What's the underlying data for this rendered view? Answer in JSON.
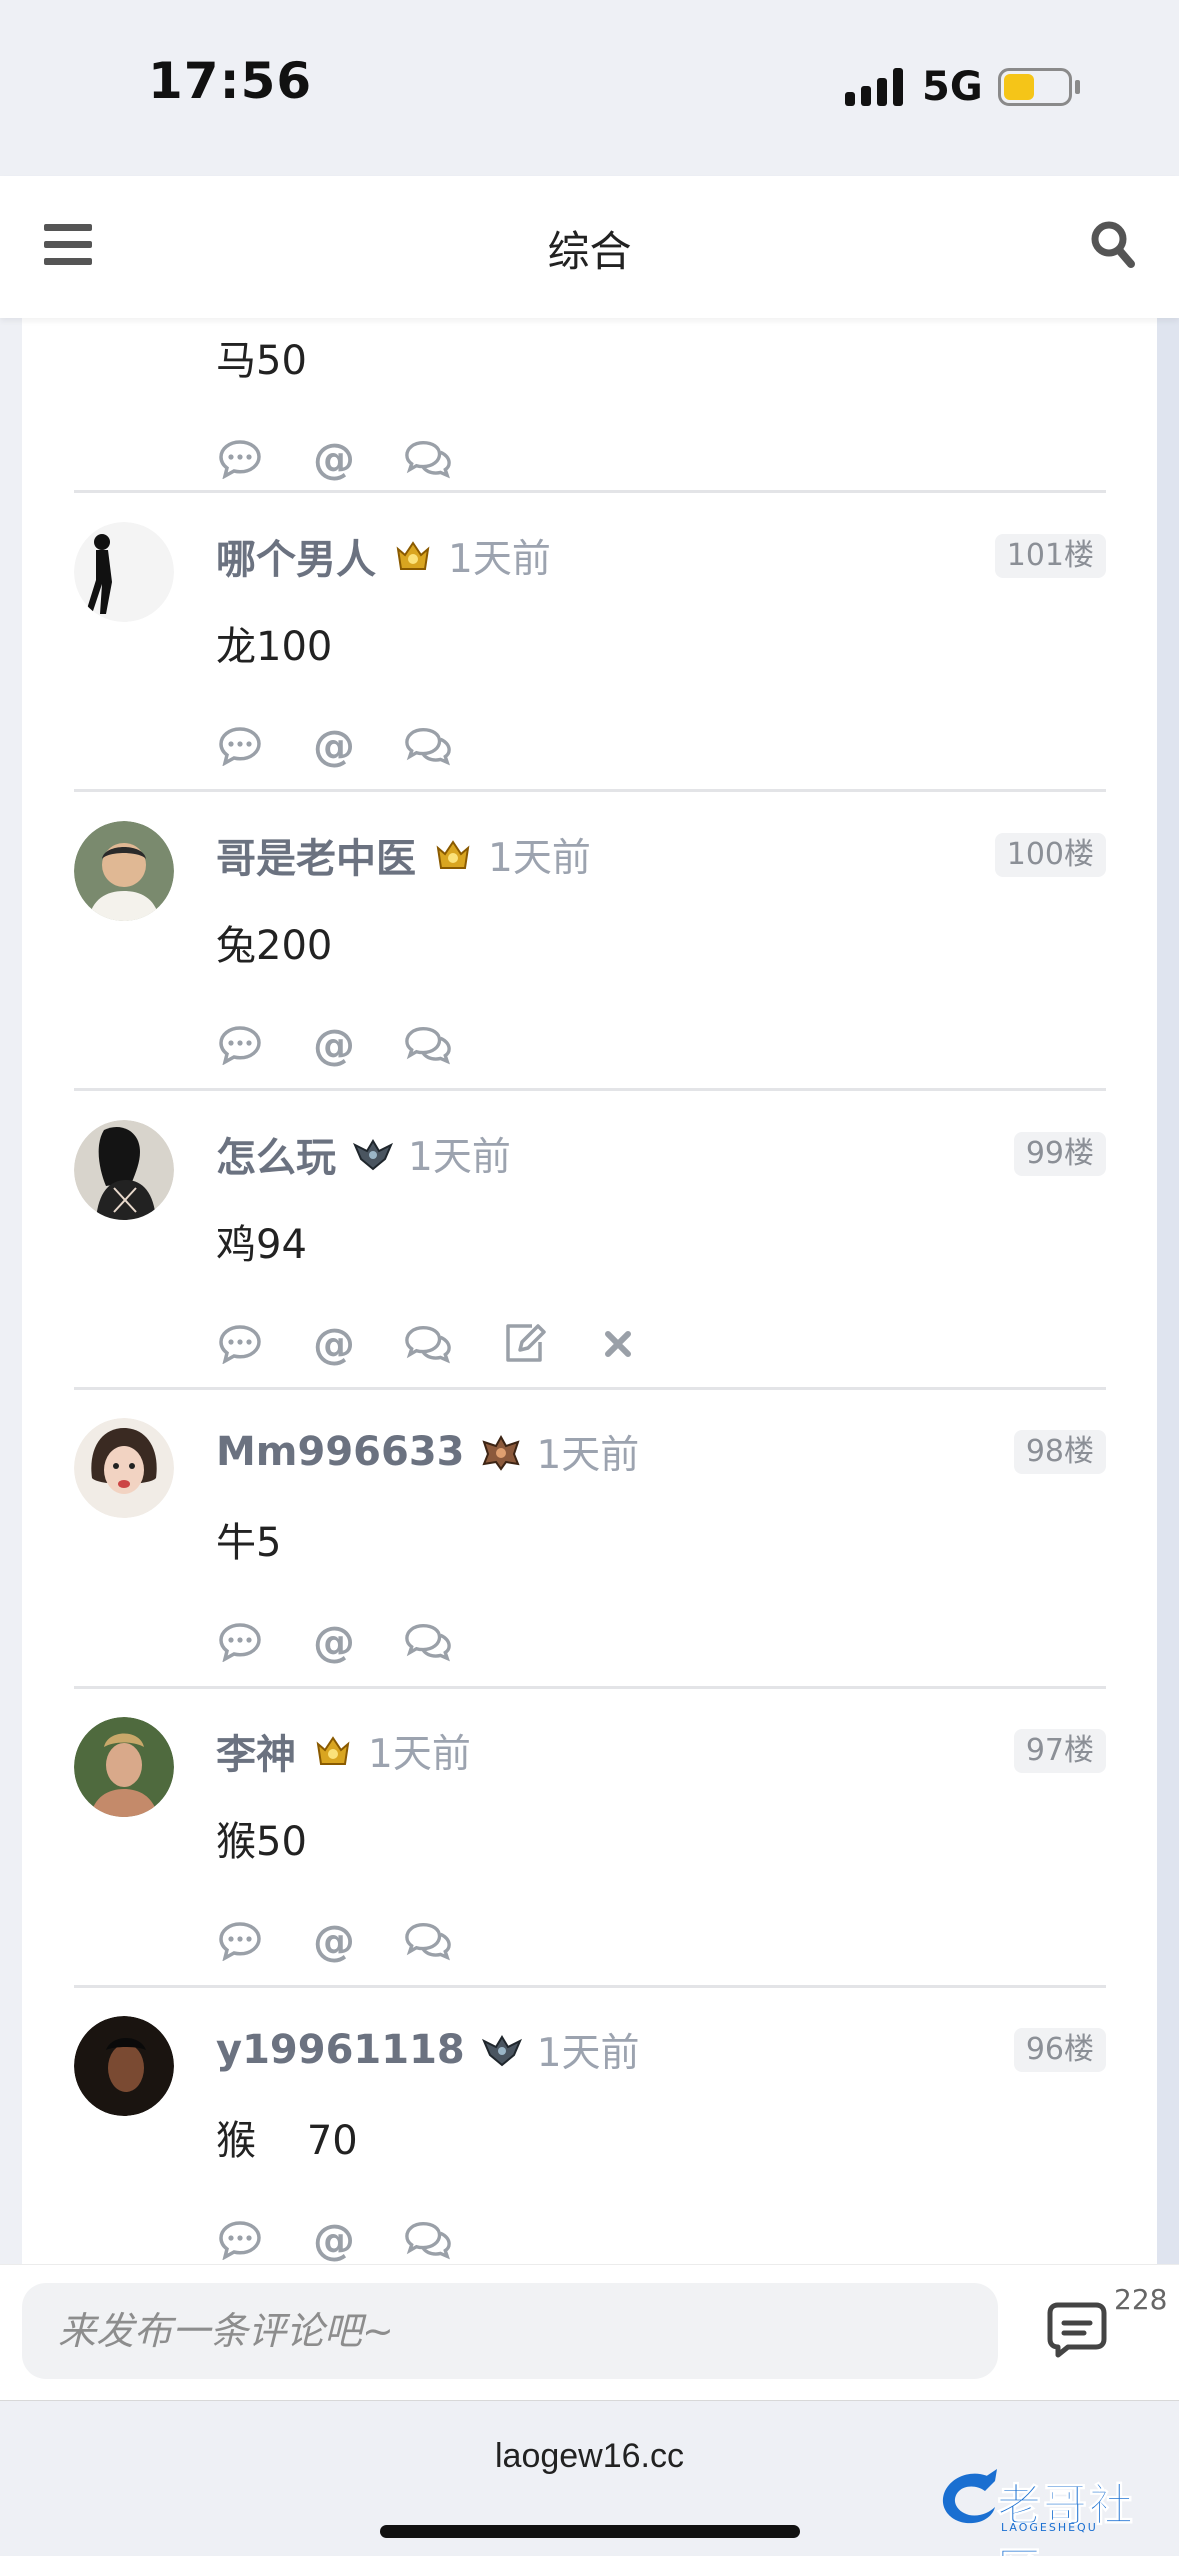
{
  "status_bar": {
    "time": "17:56",
    "network": "5G"
  },
  "header": {
    "title": "综合"
  },
  "top_partial_comment": {
    "text": "马50"
  },
  "comments": [
    {
      "username": "哪个男人",
      "badge": "gold-crown-badge",
      "time": "1天前",
      "floor": "101楼",
      "text": "龙100"
    },
    {
      "username": "哥是老中医",
      "badge": "gold-crown-badge",
      "time": "1天前",
      "floor": "100楼",
      "text": "兔200"
    },
    {
      "username": "怎么玩",
      "badge": "dark-wing-badge",
      "time": "1天前",
      "floor": "99楼",
      "text": "鸡94",
      "own": true
    },
    {
      "username": "Mm996633",
      "badge": "bronze-wing-badge",
      "time": "1天前",
      "floor": "98楼",
      "text": "牛5"
    },
    {
      "username": "李神",
      "badge": "gold-crown-badge",
      "time": "1天前",
      "floor": "97楼",
      "text": "猴50"
    },
    {
      "username": "y19961118",
      "badge": "dark-wing-badge",
      "time": "1天前",
      "floor": "96楼",
      "text": "猴    70"
    }
  ],
  "comment_bar": {
    "placeholder": "来发布一条评论吧~",
    "count": "228"
  },
  "browser": {
    "url": "laogew16.cc"
  },
  "watermark": {
    "text": "老哥社区",
    "sub": "LAOGESHEQU"
  },
  "colors": {
    "username": "#6b7280",
    "time": "#9ca3af",
    "brand": "#1a6fd1",
    "battery": "#f5c518"
  }
}
